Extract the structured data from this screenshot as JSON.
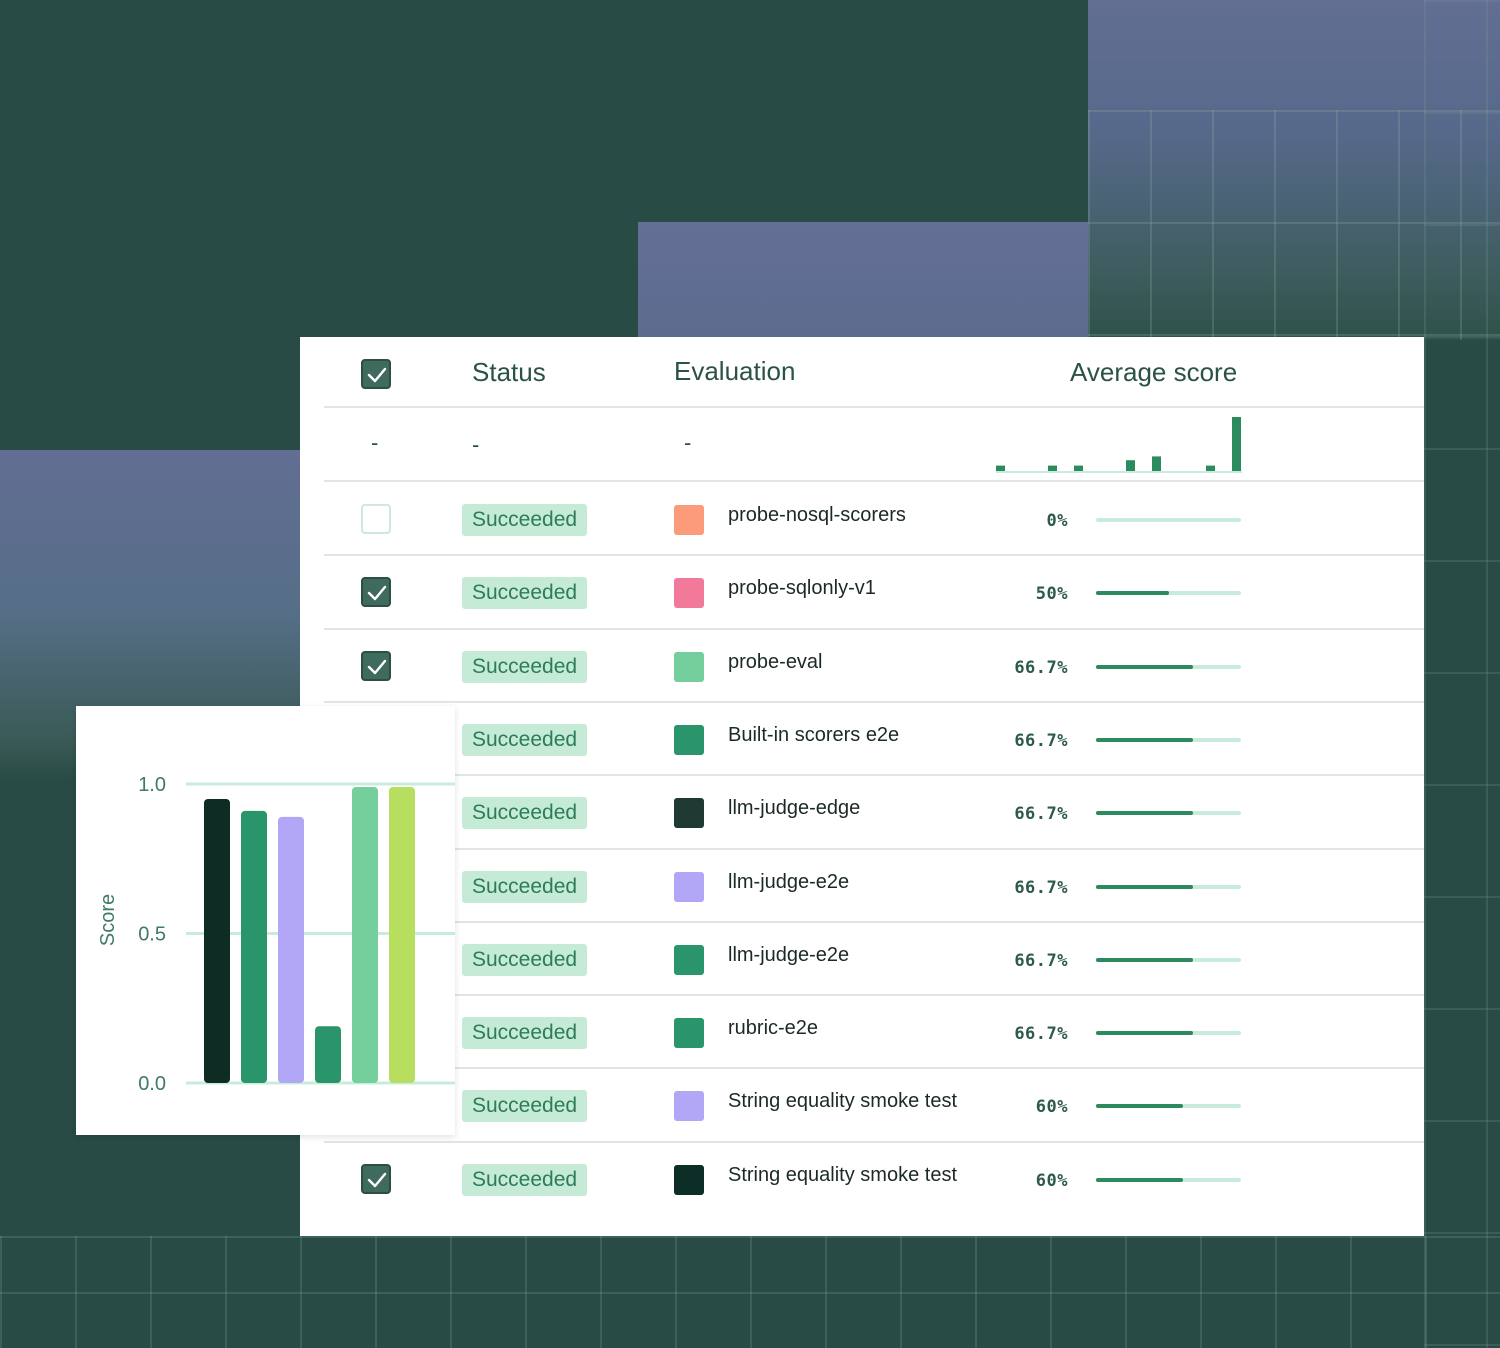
{
  "table": {
    "headers": {
      "status": "Status",
      "evaluation": "Evaluation",
      "average_score": "Average score"
    },
    "header_checkbox_checked": true,
    "filter_row": {
      "checkbox": "-",
      "status": "-",
      "evaluation": "-"
    },
    "histogram": [
      0.1,
      0.1,
      0.1,
      0.2,
      0.27,
      0.1,
      1.0
    ],
    "rows": [
      {
        "checked": false,
        "status": "Succeeded",
        "name": "probe-nosql-scorers",
        "color": "#fb9b79",
        "score_label": "0%",
        "score": 0.0
      },
      {
        "checked": true,
        "status": "Succeeded",
        "name": "probe-sqlonly-v1",
        "color": "#f2799a",
        "score_label": "50%",
        "score": 0.5
      },
      {
        "checked": true,
        "status": "Succeeded",
        "name": "probe-eval",
        "color": "#74cf9c",
        "score_label": "66.7%",
        "score": 0.667
      },
      {
        "checked": false,
        "status": "Succeeded",
        "name": "Built-in scorers e2e",
        "color": "#2a946a",
        "score_label": "66.7%",
        "score": 0.667
      },
      {
        "checked": false,
        "status": "Succeeded",
        "name": "llm-judge-edge",
        "color": "#1e3a33",
        "score_label": "66.7%",
        "score": 0.667
      },
      {
        "checked": false,
        "status": "Succeeded",
        "name": "llm-judge-e2e",
        "color": "#b2a6f6",
        "score_label": "66.7%",
        "score": 0.667
      },
      {
        "checked": false,
        "status": "Succeeded",
        "name": "llm-judge-e2e",
        "color": "#2a946a",
        "score_label": "66.7%",
        "score": 0.667
      },
      {
        "checked": false,
        "status": "Succeeded",
        "name": "rubric-e2e",
        "color": "#2a946a",
        "score_label": "66.7%",
        "score": 0.667
      },
      {
        "checked": false,
        "status": "Succeeded",
        "name": "String equality smoke test",
        "color": "#b2a6f6",
        "score_label": "60%",
        "score": 0.6
      },
      {
        "checked": true,
        "status": "Succeeded",
        "name": "String equality smoke test",
        "color": "#0d2e26",
        "score_label": "60%",
        "score": 0.6
      }
    ]
  },
  "chart_data": {
    "type": "bar",
    "ylabel": "Score",
    "ylim": [
      0,
      1.0
    ],
    "yticks": [
      "0.0",
      "0.5",
      "1.0"
    ],
    "grid": true,
    "values": [
      0.95,
      0.91,
      0.89,
      0.19,
      0.99,
      0.99
    ],
    "colors": [
      "#0e2c24",
      "#2a946a",
      "#b2a6f6",
      "#2a946a",
      "#74cf9c",
      "#b8de5f"
    ]
  },
  "colors": {
    "accent": "#2b8a5e",
    "badge_bg": "#c5ebd7",
    "badge_text": "#2c7c57",
    "background": "#284c45",
    "checkbox_on": "#3f6b5f"
  }
}
